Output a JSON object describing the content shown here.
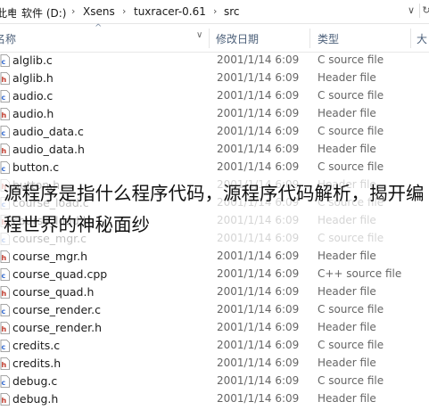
{
  "breadcrumb": {
    "segments": [
      "此电脑",
      "软件 (D:)",
      "Xsens",
      "tuxracer-0.61",
      "src"
    ]
  },
  "columns": {
    "name": "名称",
    "date": "修改日期",
    "type": "类型",
    "size": "大"
  },
  "files": [
    {
      "name": "alglib.c",
      "date": "2001/1/14 6:09",
      "type": "C source file",
      "kind": "c"
    },
    {
      "name": "alglib.h",
      "date": "2001/1/14 6:09",
      "type": "Header file",
      "kind": "h"
    },
    {
      "name": "audio.c",
      "date": "2001/1/14 6:09",
      "type": "C source file",
      "kind": "c"
    },
    {
      "name": "audio.h",
      "date": "2001/1/14 6:09",
      "type": "Header file",
      "kind": "h"
    },
    {
      "name": "audio_data.c",
      "date": "2001/1/14 6:09",
      "type": "C source file",
      "kind": "c"
    },
    {
      "name": "audio_data.h",
      "date": "2001/1/14 6:09",
      "type": "Header file",
      "kind": "h"
    },
    {
      "name": "button.c",
      "date": "2001/1/14 6:09",
      "type": "C source file",
      "kind": "c"
    },
    {
      "name": "button.h",
      "date": "2001/1/14 6:09",
      "type": "Header file",
      "kind": "h"
    },
    {
      "name": "course_load.c",
      "date": "2001/1/14 6:09",
      "type": "C source file",
      "kind": "c"
    },
    {
      "name": "course_load.h",
      "date": "2001/1/14 6:09",
      "type": "Header file",
      "kind": "h"
    },
    {
      "name": "course_mgr.c",
      "date": "2001/1/14 6:09",
      "type": "C source file",
      "kind": "c"
    },
    {
      "name": "course_mgr.h",
      "date": "2001/1/14 6:09",
      "type": "Header file",
      "kind": "h"
    },
    {
      "name": "course_quad.cpp",
      "date": "2001/1/14 6:09",
      "type": "C++ source file",
      "kind": "c"
    },
    {
      "name": "course_quad.h",
      "date": "2001/1/14 6:09",
      "type": "Header file",
      "kind": "h"
    },
    {
      "name": "course_render.c",
      "date": "2001/1/14 6:09",
      "type": "C source file",
      "kind": "c"
    },
    {
      "name": "course_render.h",
      "date": "2001/1/14 6:09",
      "type": "Header file",
      "kind": "h"
    },
    {
      "name": "credits.c",
      "date": "2001/1/14 6:09",
      "type": "C source file",
      "kind": "c"
    },
    {
      "name": "credits.h",
      "date": "2001/1/14 6:09",
      "type": "Header file",
      "kind": "h"
    },
    {
      "name": "debug.c",
      "date": "2001/1/14 6:09",
      "type": "C source file",
      "kind": "c"
    },
    {
      "name": "debug.h",
      "date": "2001/1/14 6:09",
      "type": "Header file",
      "kind": "h"
    }
  ],
  "caption": "源程序是指什么程序代码，源程序代码解析，揭开编程世界的神秘面纱",
  "colors": {
    "c_icon": "#3b6fd1",
    "h_icon": "#c0392b",
    "header_text": "#4c607a"
  }
}
